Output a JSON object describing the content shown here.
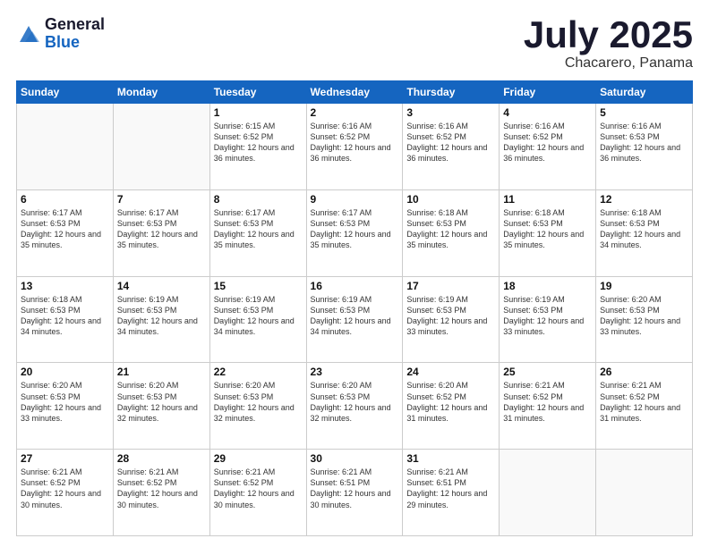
{
  "header": {
    "logo_general": "General",
    "logo_blue": "Blue",
    "month_title": "July 2025",
    "location": "Chacarero, Panama"
  },
  "weekdays": [
    "Sunday",
    "Monday",
    "Tuesday",
    "Wednesday",
    "Thursday",
    "Friday",
    "Saturday"
  ],
  "weeks": [
    [
      {
        "day": "",
        "info": ""
      },
      {
        "day": "",
        "info": ""
      },
      {
        "day": "1",
        "info": "Sunrise: 6:15 AM\nSunset: 6:52 PM\nDaylight: 12 hours\nand 36 minutes."
      },
      {
        "day": "2",
        "info": "Sunrise: 6:16 AM\nSunset: 6:52 PM\nDaylight: 12 hours\nand 36 minutes."
      },
      {
        "day": "3",
        "info": "Sunrise: 6:16 AM\nSunset: 6:52 PM\nDaylight: 12 hours\nand 36 minutes."
      },
      {
        "day": "4",
        "info": "Sunrise: 6:16 AM\nSunset: 6:52 PM\nDaylight: 12 hours\nand 36 minutes."
      },
      {
        "day": "5",
        "info": "Sunrise: 6:16 AM\nSunset: 6:53 PM\nDaylight: 12 hours\nand 36 minutes."
      }
    ],
    [
      {
        "day": "6",
        "info": "Sunrise: 6:17 AM\nSunset: 6:53 PM\nDaylight: 12 hours\nand 35 minutes."
      },
      {
        "day": "7",
        "info": "Sunrise: 6:17 AM\nSunset: 6:53 PM\nDaylight: 12 hours\nand 35 minutes."
      },
      {
        "day": "8",
        "info": "Sunrise: 6:17 AM\nSunset: 6:53 PM\nDaylight: 12 hours\nand 35 minutes."
      },
      {
        "day": "9",
        "info": "Sunrise: 6:17 AM\nSunset: 6:53 PM\nDaylight: 12 hours\nand 35 minutes."
      },
      {
        "day": "10",
        "info": "Sunrise: 6:18 AM\nSunset: 6:53 PM\nDaylight: 12 hours\nand 35 minutes."
      },
      {
        "day": "11",
        "info": "Sunrise: 6:18 AM\nSunset: 6:53 PM\nDaylight: 12 hours\nand 35 minutes."
      },
      {
        "day": "12",
        "info": "Sunrise: 6:18 AM\nSunset: 6:53 PM\nDaylight: 12 hours\nand 34 minutes."
      }
    ],
    [
      {
        "day": "13",
        "info": "Sunrise: 6:18 AM\nSunset: 6:53 PM\nDaylight: 12 hours\nand 34 minutes."
      },
      {
        "day": "14",
        "info": "Sunrise: 6:19 AM\nSunset: 6:53 PM\nDaylight: 12 hours\nand 34 minutes."
      },
      {
        "day": "15",
        "info": "Sunrise: 6:19 AM\nSunset: 6:53 PM\nDaylight: 12 hours\nand 34 minutes."
      },
      {
        "day": "16",
        "info": "Sunrise: 6:19 AM\nSunset: 6:53 PM\nDaylight: 12 hours\nand 34 minutes."
      },
      {
        "day": "17",
        "info": "Sunrise: 6:19 AM\nSunset: 6:53 PM\nDaylight: 12 hours\nand 33 minutes."
      },
      {
        "day": "18",
        "info": "Sunrise: 6:19 AM\nSunset: 6:53 PM\nDaylight: 12 hours\nand 33 minutes."
      },
      {
        "day": "19",
        "info": "Sunrise: 6:20 AM\nSunset: 6:53 PM\nDaylight: 12 hours\nand 33 minutes."
      }
    ],
    [
      {
        "day": "20",
        "info": "Sunrise: 6:20 AM\nSunset: 6:53 PM\nDaylight: 12 hours\nand 33 minutes."
      },
      {
        "day": "21",
        "info": "Sunrise: 6:20 AM\nSunset: 6:53 PM\nDaylight: 12 hours\nand 32 minutes."
      },
      {
        "day": "22",
        "info": "Sunrise: 6:20 AM\nSunset: 6:53 PM\nDaylight: 12 hours\nand 32 minutes."
      },
      {
        "day": "23",
        "info": "Sunrise: 6:20 AM\nSunset: 6:53 PM\nDaylight: 12 hours\nand 32 minutes."
      },
      {
        "day": "24",
        "info": "Sunrise: 6:20 AM\nSunset: 6:52 PM\nDaylight: 12 hours\nand 31 minutes."
      },
      {
        "day": "25",
        "info": "Sunrise: 6:21 AM\nSunset: 6:52 PM\nDaylight: 12 hours\nand 31 minutes."
      },
      {
        "day": "26",
        "info": "Sunrise: 6:21 AM\nSunset: 6:52 PM\nDaylight: 12 hours\nand 31 minutes."
      }
    ],
    [
      {
        "day": "27",
        "info": "Sunrise: 6:21 AM\nSunset: 6:52 PM\nDaylight: 12 hours\nand 30 minutes."
      },
      {
        "day": "28",
        "info": "Sunrise: 6:21 AM\nSunset: 6:52 PM\nDaylight: 12 hours\nand 30 minutes."
      },
      {
        "day": "29",
        "info": "Sunrise: 6:21 AM\nSunset: 6:52 PM\nDaylight: 12 hours\nand 30 minutes."
      },
      {
        "day": "30",
        "info": "Sunrise: 6:21 AM\nSunset: 6:51 PM\nDaylight: 12 hours\nand 30 minutes."
      },
      {
        "day": "31",
        "info": "Sunrise: 6:21 AM\nSunset: 6:51 PM\nDaylight: 12 hours\nand 29 minutes."
      },
      {
        "day": "",
        "info": ""
      },
      {
        "day": "",
        "info": ""
      }
    ]
  ]
}
